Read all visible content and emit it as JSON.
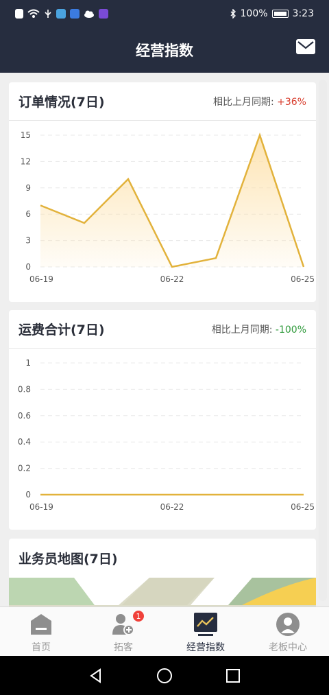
{
  "status_bar": {
    "battery": "100%",
    "time": "3:23"
  },
  "header": {
    "title": "经营指数"
  },
  "cards": [
    {
      "title": "订单情况(7日)",
      "compare_label": "相比上月同期:",
      "compare_value": "+36%",
      "compare_color": "#d73a2a"
    },
    {
      "title": "运费合计(7日)",
      "compare_label": "相比上月同期:",
      "compare_value": "-100%",
      "compare_color": "#2f9a3b"
    },
    {
      "title": "业务员地图(7日)"
    }
  ],
  "chart_data": [
    {
      "type": "area",
      "x": [
        "06-19",
        "06-20",
        "06-21",
        "06-22",
        "06-23",
        "06-24",
        "06-25"
      ],
      "x_tick_labels": [
        "06-19",
        "06-22",
        "06-25"
      ],
      "series": [
        {
          "values": [
            7,
            5,
            10,
            0,
            1,
            15,
            0
          ]
        }
      ],
      "y_ticks": [
        0,
        3,
        6,
        9,
        12,
        15
      ],
      "ylim": [
        0,
        15
      ],
      "grid": true,
      "line_color": "#e2b23b",
      "fill_color": "#fde3b0"
    },
    {
      "type": "line",
      "x": [
        "06-19",
        "06-20",
        "06-21",
        "06-22",
        "06-23",
        "06-24",
        "06-25"
      ],
      "x_tick_labels": [
        "06-19",
        "06-22",
        "06-25"
      ],
      "series": [
        {
          "values": [
            0,
            0,
            0,
            0,
            0,
            0,
            0
          ]
        }
      ],
      "y_ticks": [
        0,
        0.2,
        0.4,
        0.6,
        0.8,
        1
      ],
      "ylim": [
        0,
        1
      ],
      "grid": true,
      "line_color": "#e2b23b"
    }
  ],
  "tabs": [
    {
      "label": "首页",
      "icon": "home-icon",
      "active": false
    },
    {
      "label": "拓客",
      "icon": "add-customer-icon",
      "active": false,
      "badge": "1"
    },
    {
      "label": "经营指数",
      "icon": "trend-chart-icon",
      "active": true
    },
    {
      "label": "老板中心",
      "icon": "boss-center-icon",
      "active": false
    }
  ]
}
